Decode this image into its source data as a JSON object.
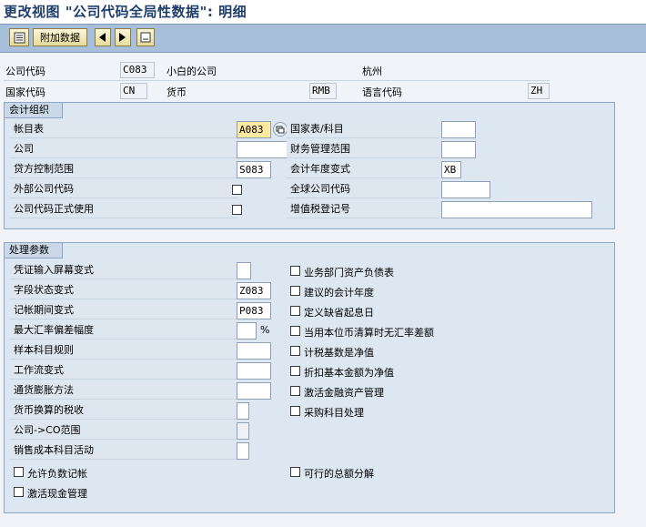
{
  "title": "更改视图 \"公司代码全局性数据\": 明细",
  "toolbar": {
    "additional_data": "附加数据"
  },
  "header": {
    "company_code_label": "公司代码",
    "company_code": "C083",
    "company_name": "小白的公司",
    "city": "杭州",
    "country_label": "国家代码",
    "country": "CN",
    "currency_label": "货币",
    "currency": "RMB",
    "language_label": "语言代码",
    "language": "ZH"
  },
  "accounting": {
    "title": "会计组织",
    "chart_label": "帐目表",
    "chart": "A083",
    "country_chart_label": "国家表/科目",
    "country_chart": "",
    "company_label": "公司",
    "company": "",
    "fm_area_label": "财务管理范围",
    "fm_area": "",
    "credit_area_label": "贷方控制范围",
    "credit_area": "S083",
    "fy_variant_label": "会计年度变式",
    "fy_variant": "XB",
    "ext_code_label": "外部公司代码",
    "global_code_label": "全球公司代码",
    "global_code": "",
    "productive_label": "公司代码正式使用",
    "vat_label": "增值税登记号",
    "vat": ""
  },
  "processing": {
    "title": "处理参数",
    "rows": [
      {
        "label": "凭证输入屏幕变式",
        "value": ""
      },
      {
        "label": "字段状态变式",
        "value": "Z083"
      },
      {
        "label": "记帐期间变式",
        "value": "P083"
      },
      {
        "label": "最大汇率偏差幅度",
        "value": ""
      },
      {
        "label": "样本科目规则",
        "value": ""
      },
      {
        "label": "工作流变式",
        "value": ""
      },
      {
        "label": "通货膨胀方法",
        "value": ""
      },
      {
        "label": "货币换算的税收",
        "value": ""
      },
      {
        "label": "公司->CO范围",
        "value": ""
      },
      {
        "label": "销售成本科目活动",
        "value": ""
      }
    ],
    "percent": "%",
    "right_checks": [
      "业务部门资产负债表",
      "建议的会计年度",
      "定义缺省起息日",
      "当用本位币清算时无汇率差额",
      "计税基数是净值",
      "折扣基本金额为净值",
      "激活金融资产管理",
      "采购科目处理"
    ],
    "neg_postings": "允许负数记帐",
    "cash_mgmt": "激活现金管理",
    "split": "可行的总额分解"
  }
}
